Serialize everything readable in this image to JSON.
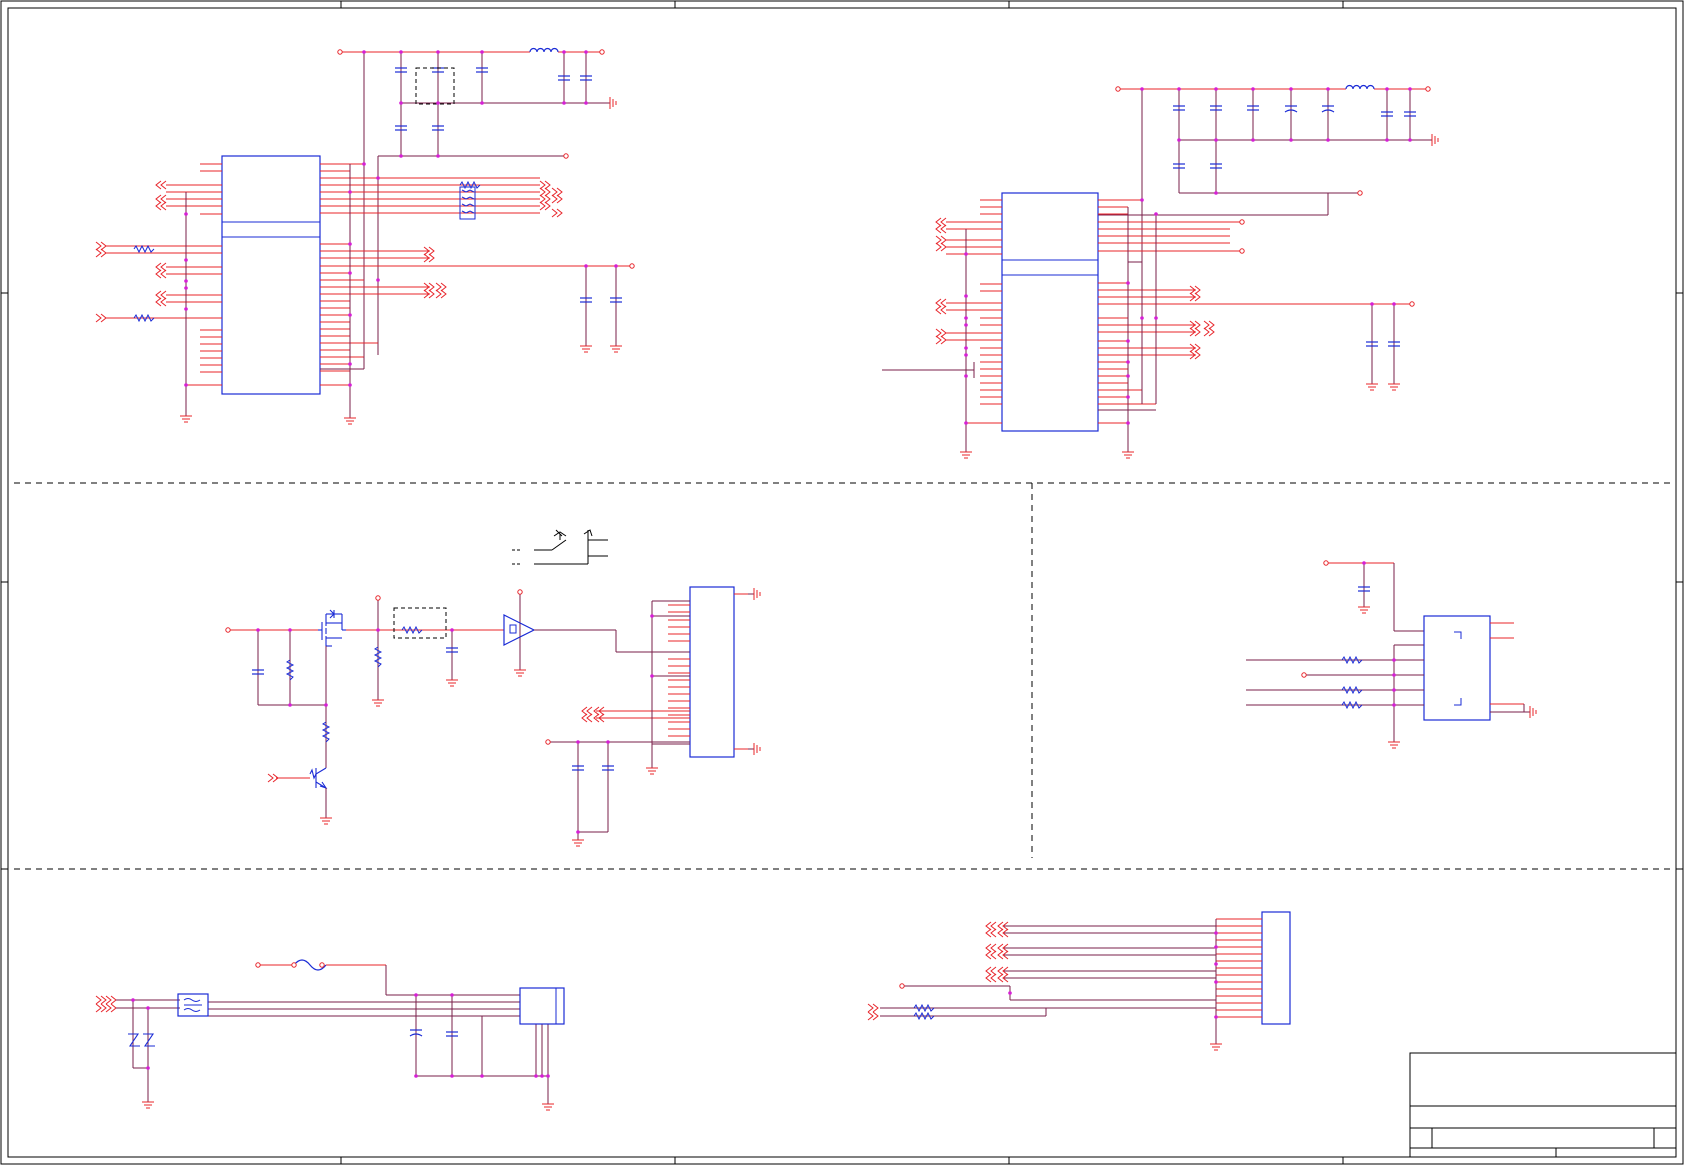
{
  "sheet": {
    "description": "",
    "colors": {
      "wire": "#7a1f4a",
      "pin": "#e8242a",
      "part": "#1a2bd6",
      "junction": "#d61fd6",
      "frame": "#000000",
      "divider": "#000000"
    }
  },
  "sections": [
    {
      "id": "ic-top-left",
      "parts": [
        "ic",
        "resistor-array",
        "decoupling-capacitors",
        "inductor"
      ]
    },
    {
      "id": "ic-top-right",
      "parts": [
        "ic",
        "decoupling-capacitors",
        "inductor"
      ]
    },
    {
      "id": "power-switch",
      "parts": [
        "mosfet",
        "npn-transistor",
        "resistors",
        "capacitors",
        "buffer",
        "connector"
      ]
    },
    {
      "id": "right-middle",
      "parts": [
        "ic",
        "resistors",
        "capacitor"
      ]
    },
    {
      "id": "bottom-left",
      "parts": [
        "common-mode-choke",
        "tvs-diodes",
        "fuse",
        "capacitors",
        "connector"
      ]
    },
    {
      "id": "bottom-right",
      "parts": [
        "connector",
        "resistor"
      ]
    }
  ],
  "title_block": {
    "title": "",
    "size": "",
    "number": "",
    "rev": ""
  }
}
